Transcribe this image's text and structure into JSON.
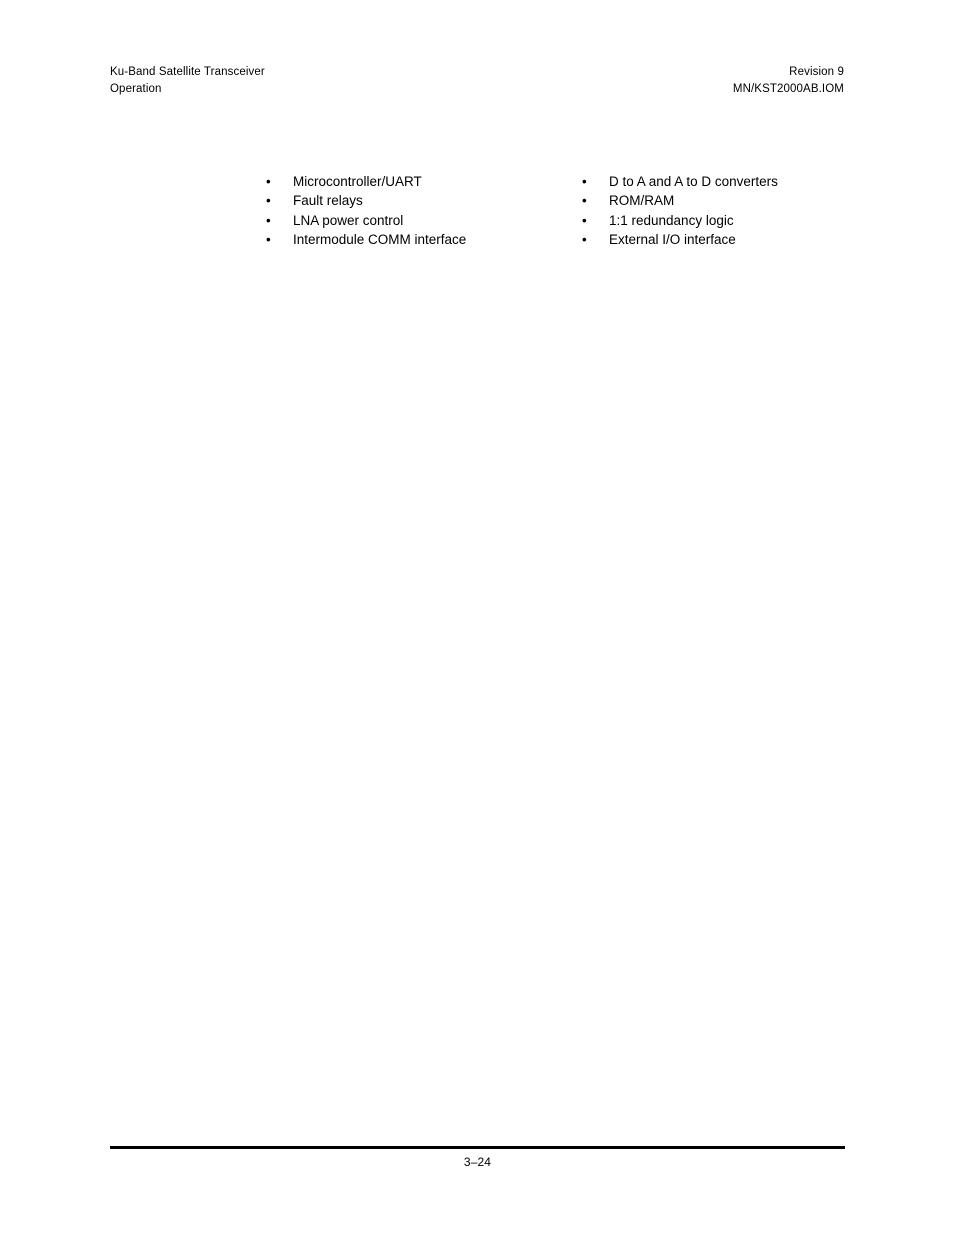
{
  "document": {
    "header": {
      "left_lines": [
        "Ku-Band Satellite Transceiver",
        "Operation"
      ],
      "right_lines": [
        "Revision 9",
        "MN/KST2000AB.IOM"
      ]
    },
    "body": {
      "bullet_marker": "•",
      "columns": [
        {
          "id": "left",
          "items": [
            "Microcontroller/UART",
            "Fault relays",
            "LNA power control",
            "Intermodule COMM interface"
          ]
        },
        {
          "id": "right",
          "items": [
            "D to A and A to D converters",
            "ROM/RAM",
            "1:1 redundancy logic",
            "External I/O interface"
          ]
        }
      ]
    },
    "footer": {
      "page_number": "3–24"
    },
    "colors": {
      "text": "#000000",
      "background": "#ffffff",
      "rule": "#000000"
    }
  }
}
